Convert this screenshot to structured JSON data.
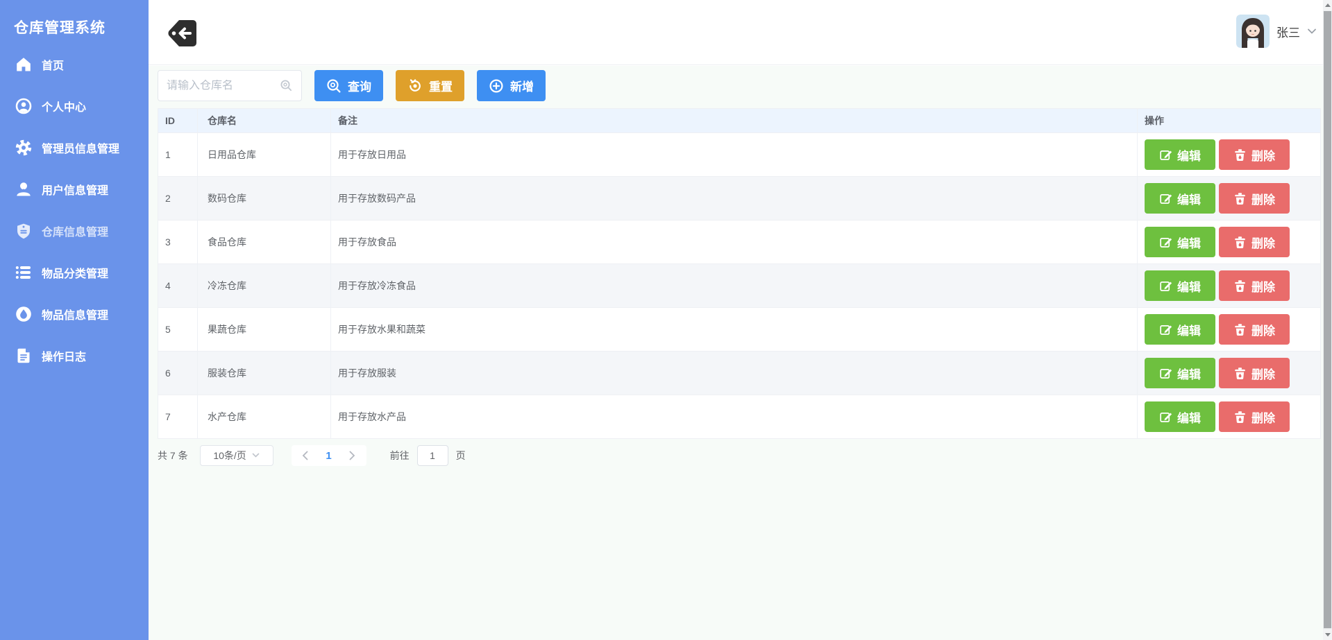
{
  "app": {
    "title": "仓库管理系统"
  },
  "sidebar": {
    "items": [
      {
        "label": "首页",
        "icon": "home-icon",
        "active": false
      },
      {
        "label": "个人中心",
        "icon": "user-circle-icon",
        "active": false
      },
      {
        "label": "管理员信息管理",
        "icon": "gear-icon",
        "active": false
      },
      {
        "label": "用户信息管理",
        "icon": "user-icon",
        "active": false
      },
      {
        "label": "仓库信息管理",
        "icon": "shield-icon",
        "active": true
      },
      {
        "label": "物品分类管理",
        "icon": "list-icon",
        "active": false
      },
      {
        "label": "物品信息管理",
        "icon": "drop-icon",
        "active": false
      },
      {
        "label": "操作日志",
        "icon": "document-icon",
        "active": false
      }
    ]
  },
  "topbar": {
    "user_name": "张三"
  },
  "toolbar": {
    "search_placeholder": "请输入仓库名",
    "query_label": "查询",
    "reset_label": "重置",
    "add_label": "新增"
  },
  "table": {
    "columns": [
      "ID",
      "仓库名",
      "备注",
      "操作"
    ],
    "edit_label": "编辑",
    "delete_label": "删除",
    "rows": [
      {
        "id": "1",
        "name": "日用品仓库",
        "remark": "用于存放日用品"
      },
      {
        "id": "2",
        "name": "数码仓库",
        "remark": "用于存放数码产品"
      },
      {
        "id": "3",
        "name": "食品仓库",
        "remark": "用于存放食品"
      },
      {
        "id": "4",
        "name": "冷冻仓库",
        "remark": "用于存放冷冻食品"
      },
      {
        "id": "5",
        "name": "果蔬仓库",
        "remark": "用于存放水果和蔬菜"
      },
      {
        "id": "6",
        "name": "服装仓库",
        "remark": "用于存放服装"
      },
      {
        "id": "7",
        "name": "水产仓库",
        "remark": "用于存放水产品"
      }
    ]
  },
  "pagination": {
    "total_text": "共 7 条",
    "page_size": "10条/页",
    "current_page": "1",
    "goto_label": "前往",
    "goto_value": "1",
    "page_unit": "页"
  },
  "colors": {
    "sidebar_blue": "#6a93ea",
    "primary_blue": "#3e8ff2",
    "warning_orange": "#dfa02b",
    "success_green": "#6ec03f",
    "danger_red": "#e96c6b",
    "table_header_bg": "#ecf4fe",
    "stripe_bg": "#f4f6f9"
  }
}
